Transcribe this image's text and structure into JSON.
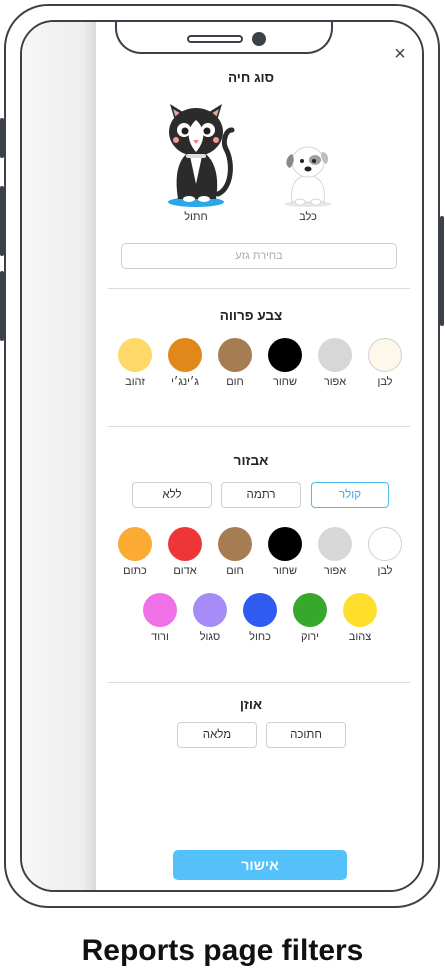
{
  "close_label": "×",
  "animal_type": {
    "title": "סוג חיה",
    "cat_label": "חתול",
    "dog_label": "כלב",
    "breed_placeholder": "בחירת גזע"
  },
  "fur_color": {
    "title": "צבע פרווה",
    "items": [
      {
        "label": "לבן",
        "color": "#fdf8ea"
      },
      {
        "label": "אפור",
        "color": "#d7d7d7"
      },
      {
        "label": "שחור",
        "color": "#000000"
      },
      {
        "label": "חום",
        "color": "#a67c52"
      },
      {
        "label": "ג׳ינג׳י",
        "color": "#e0881a"
      },
      {
        "label": "זהוב",
        "color": "#ffd86a"
      }
    ]
  },
  "accessory": {
    "title": "אבזור",
    "types": [
      "קולר",
      "רתמה",
      "ללא"
    ],
    "selected_type": "קולר",
    "colors_row1": [
      {
        "label": "לבן",
        "color": "#ffffff"
      },
      {
        "label": "אפור",
        "color": "#d7d7d7"
      },
      {
        "label": "שחור",
        "color": "#000000"
      },
      {
        "label": "חום",
        "color": "#a67c52"
      },
      {
        "label": "אדום",
        "color": "#ee3537"
      },
      {
        "label": "כתום",
        "color": "#fbaa33"
      }
    ],
    "colors_row2": [
      {
        "label": "צהוב",
        "color": "#ffdf2b"
      },
      {
        "label": "ירוק",
        "color": "#36a82b"
      },
      {
        "label": "כחול",
        "color": "#2f5bf0"
      },
      {
        "label": "סגול",
        "color": "#a58cf7"
      },
      {
        "label": "ורוד",
        "color": "#ef71e8"
      }
    ]
  },
  "ear": {
    "title": "אוזן",
    "options": [
      "חתוכה",
      "מלאה"
    ]
  },
  "confirm_label": "אישור",
  "caption": "Reports page filters"
}
